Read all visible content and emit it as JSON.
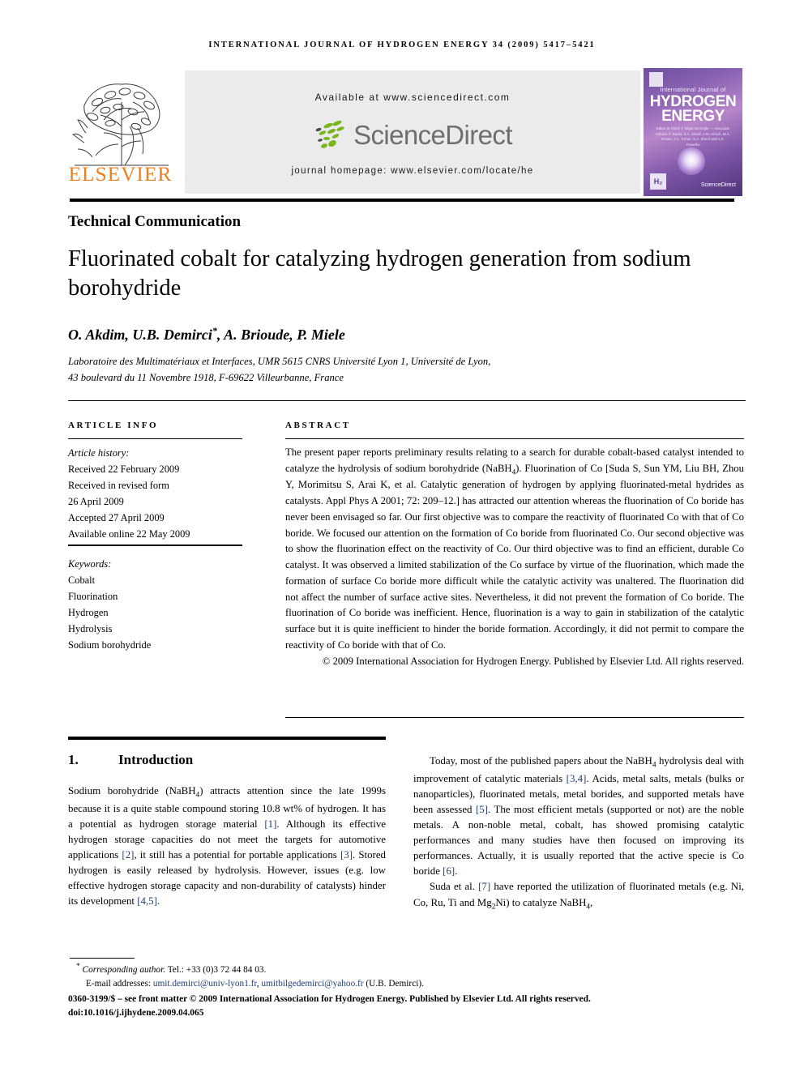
{
  "running_head": "International Journal of Hydrogen Energy 34 (2009) 5417–5421",
  "banner": {
    "elsevier_wordmark": "ELSEVIER",
    "available_at": "Available at www.sciencedirect.com",
    "sciencedirect_wordmark": "ScienceDirect",
    "journal_homepage": "journal homepage: www.elsevier.com/locate/he",
    "accent_orange": "#F07C1A",
    "sciencedirect_gray": "#6E6E6E",
    "banner_bg": "#EBEBEB"
  },
  "cover": {
    "subtitle": "International Journal of",
    "title_line1": "HYDROGEN",
    "title_line2": "ENERGY",
    "editors": "Editor-in-Chief: T. Nejat Veziroğlu — Associate Editors: F. Barbir, S.A. Sherif, A.M. Hirsch, M.A. Rosen, J.A. Turner, S.A. Sherif and A.S. Travelho",
    "badge": "H₂",
    "sciencedirect": "ScienceDirect",
    "cover_purple": "#6D4F9E"
  },
  "article": {
    "type": "Technical Communication",
    "title": "Fluorinated cobalt for catalyzing hydrogen generation from sodium borohydride",
    "authors": "O. Akdim, U.B. Demirci",
    "authors_rest": ", A. Brioude, P. Miele",
    "corresponding_marker": "*",
    "affiliation_line1": "Laboratoire des Multimatériaux et Interfaces, UMR 5615 CNRS Université Lyon 1, Université de Lyon,",
    "affiliation_line2": "43 boulevard du 11 Novembre 1918, F-69622 Villeurbanne, France"
  },
  "article_info": {
    "heading": "ARTICLE INFO",
    "history_label": "Article history:",
    "history": [
      "Received 22 February 2009",
      "Received in revised form",
      "26 April 2009",
      "Accepted 27 April 2009",
      "Available online 22 May 2009"
    ],
    "keywords_label": "Keywords:",
    "keywords": [
      "Cobalt",
      "Fluorination",
      "Hydrogen",
      "Hydrolysis",
      "Sodium borohydride"
    ]
  },
  "abstract": {
    "heading": "ABSTRACT",
    "body": "The present paper reports preliminary results relating to a search for durable cobalt-based catalyst intended to catalyze the hydrolysis of sodium borohydride (NaBH4). Fluorination of Co [Suda S, Sun YM, Liu BH, Zhou Y, Morimitsu S, Arai K, et al. Catalytic generation of hydrogen by applying fluorinated-metal hydrides as catalysts. Appl Phys A 2001; 72: 209–12.] has attracted our attention whereas the fluorination of Co boride has never been envisaged so far. Our first objective was to compare the reactivity of fluorinated Co with that of Co boride. We focused our attention on the formation of Co boride from fluorinated Co. Our second objective was to show the fluorination effect on the reactivity of Co. Our third objective was to find an efficient, durable Co catalyst. It was observed a limited stabilization of the Co surface by virtue of the fluorination, which made the formation of surface Co boride more difficult while the catalytic activity was unaltered. The fluorination did not affect the number of surface active sites. Nevertheless, it did not prevent the formation of Co boride. The fluorination of Co boride was inefficient. Hence, fluorination is a way to gain in stabilization of the catalytic surface but it is quite inefficient to hinder the boride formation. Accordingly, it did not permit to compare the reactivity of Co boride with that of Co.",
    "copyright": "© 2009 International Association for Hydrogen Energy. Published by Elsevier Ltd. All rights reserved."
  },
  "body": {
    "section_number": "1.",
    "section_title": "Introduction",
    "left_paragraph": "Sodium borohydride (NaBH4) attracts attention since the late 1999s because it is a quite stable compound storing 10.8 wt% of hydrogen. It has a potential as hydrogen storage material [1]. Although its effective hydrogen storage capacities do not meet the targets for automotive applications [2], it still has a potential for portable applications [3]. Stored hydrogen is easily released by hydrolysis. However, issues (e.g. low effective hydrogen storage capacity and non-durability of catalysts) hinder its development [4,5].",
    "right_paragraph_1": "Today, most of the published papers about the NaBH4 hydrolysis deal with improvement of catalytic materials [3,4]. Acids, metal salts, metals (bulks or nanoparticles), fluorinated metals, metal borides, and supported metals have been assessed [5]. The most efficient metals (supported or not) are the noble metals. A non-noble metal, cobalt, has showed promising catalytic performances and many studies have then focused on improving its performances. Actually, it is usually reported that the active specie is Co boride [6].",
    "right_paragraph_2": "Suda et al. [7] have reported the utilization of fluorinated metals (e.g. Ni, Co, Ru, Ti and Mg2Ni) to catalyze NaBH4,"
  },
  "footnote": {
    "corresponding_label": "Corresponding author.",
    "tel": "Tel.: +33 (0)3 72 44 84 03.",
    "email_label": "E-mail addresses:",
    "email_1": "umit.demirci@univ-lyon1.fr",
    "email_2": "umitbilgedemirci@yahoo.fr",
    "email_owner": "(U.B. Demirci).",
    "issn_line": "0360-3199/$ – see front matter © 2009 International Association for Hydrogen Energy. Published by Elsevier Ltd. All rights reserved.",
    "doi_line": "doi:10.1016/j.ijhydene.2009.04.065",
    "link_color": "#1F3D7A"
  }
}
